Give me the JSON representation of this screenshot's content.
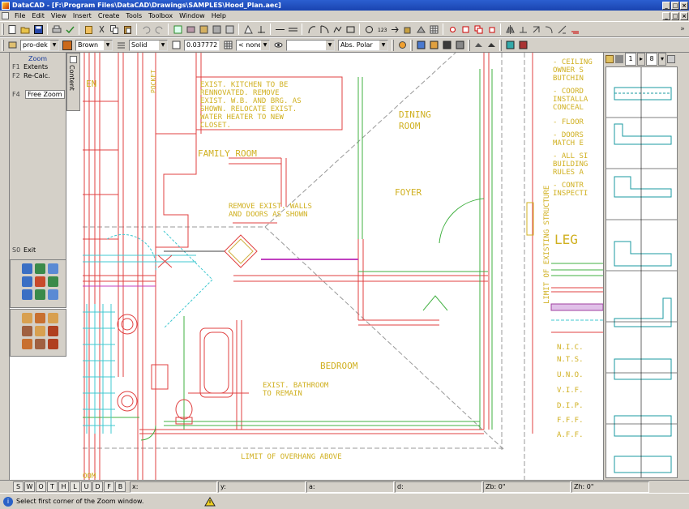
{
  "window": {
    "title": "DataCAD - [F:\\Program Files\\DataCAD\\Drawings\\SAMPLES\\Hood_Plan.aec]",
    "buttons": [
      "_",
      "□",
      "×"
    ]
  },
  "menu": {
    "items": [
      "File",
      "Edit",
      "View",
      "Insert",
      "Create",
      "Tools",
      "Toolbox",
      "Window",
      "Help"
    ]
  },
  "toolbar2": {
    "layer": "pro-dek",
    "color_name": "Brown",
    "color_hex": "#cc6a1a",
    "linetype": "Solid",
    "line_weight": "0.037772",
    "pen": "< none >",
    "coord_mode": "Abs. Polar"
  },
  "left_panel": {
    "title": "Zoom",
    "items": [
      {
        "key": "F1",
        "label": "Extents"
      },
      {
        "key": "F2",
        "label": "Re-Calc."
      },
      {
        "key": "F4",
        "label": "Free Zoom"
      },
      {
        "key": "S0",
        "label": "Exit"
      }
    ],
    "content_tab": "Content"
  },
  "drawing": {
    "labels": {
      "room_top_left": "EN",
      "family_room": "FAMILY ROOM",
      "dining": "DINING",
      "dining_room": "ROOM",
      "foyer": "FOYER",
      "bedroom": "BEDROOM",
      "pocket": "POCKET",
      "ovr": "OVR",
      "limit_existing": "LIMIT OF EXISTING STRUCTURE",
      "limit_overhang": "LIMIT OF OVERHANG ABOVE",
      "legend_partial": "LEG",
      "bottom_left_partial": "OOM"
    },
    "notes": {
      "kitchen": [
        "EXIST. KITCHEN TO BE",
        "RENNOVATED. REMOVE",
        "EXIST. W.B. AND BRG. AS",
        "SHOWN. RELOCATE EXIST.",
        "WATER HEATER TO NEW",
        "CLOSET."
      ],
      "remove_walls": [
        "REMOVE EXIST. WALLS",
        "AND DOORS AS SHOWN"
      ],
      "bathroom": [
        "EXIST. BATHROOM",
        "TO REMAIN"
      ],
      "right_notes": [
        "- CEILING",
        "OWNER S",
        "BUTCHIN",
        "- COORD",
        "INSTALLA",
        "CONCEAL",
        "- FLOOR",
        "- DOORS",
        "MATCH E",
        "- ALL SI",
        "BUILDING",
        "RULES A",
        "- CONTR",
        "INSPECTI"
      ],
      "abbreviations": [
        "N.I.C.",
        "N.T.S.",
        "U.N.O.",
        "V.I.F.",
        "D.I.P.",
        "F.F.F.",
        "A.F.F."
      ]
    }
  },
  "right_panel": {
    "page": "1",
    "count": "8"
  },
  "layer_tabs": [
    "S",
    "W",
    "O",
    "T",
    "H",
    "L",
    "U",
    "D",
    "F",
    "B"
  ],
  "coords": {
    "x": "x:",
    "y": "y:",
    "a": "a:",
    "d": "d:",
    "zb": "Zb: 0\"",
    "zh": "Zh: 0\""
  },
  "status": {
    "message": "Select first corner of the Zoom window."
  }
}
